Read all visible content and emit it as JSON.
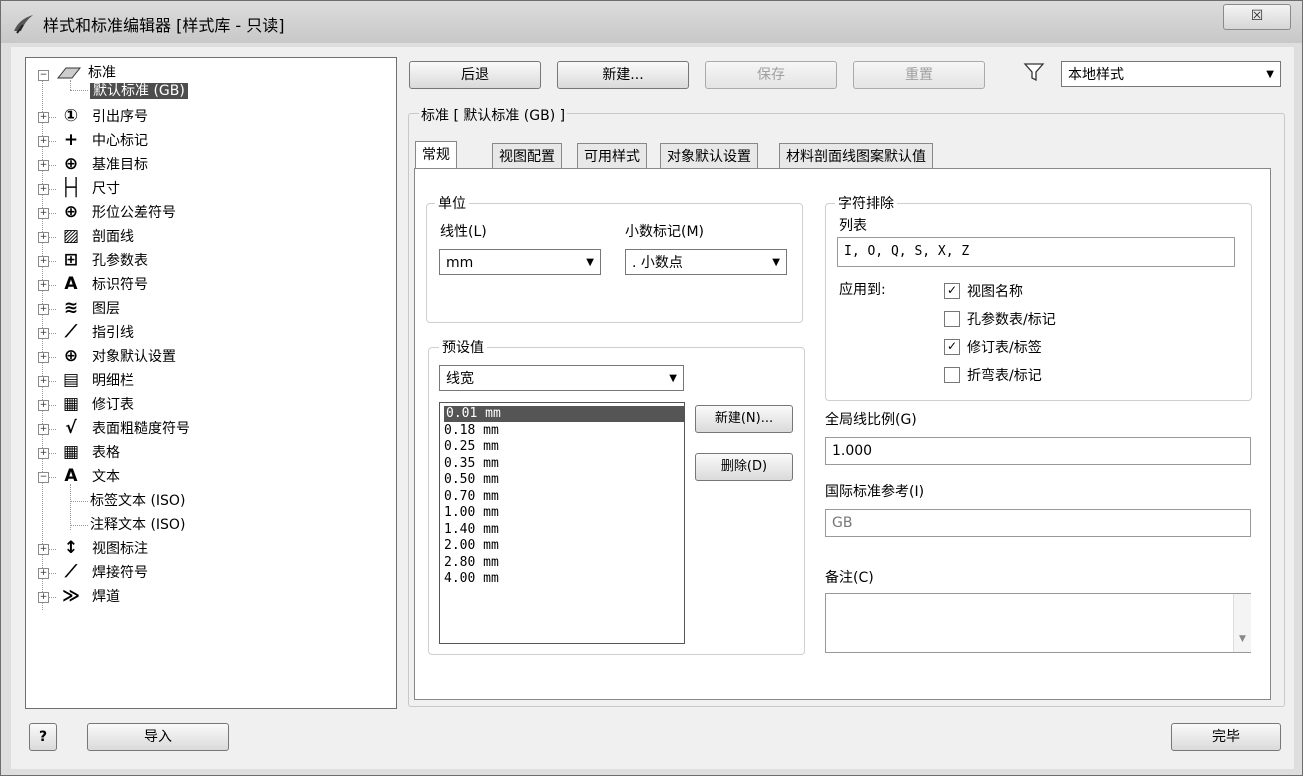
{
  "window": {
    "title": "样式和标准编辑器 [样式库 - 只读]",
    "close_label": "☒"
  },
  "tree": {
    "root_label": "标准",
    "selected_label": "默认标准 (GB)",
    "items": [
      {
        "label": "引出序号",
        "icon": "balloon-icon",
        "glyph": "①"
      },
      {
        "label": "中心标记",
        "icon": "center-mark-icon",
        "glyph": "+"
      },
      {
        "label": "基准目标",
        "icon": "datum-target-icon",
        "glyph": "⊕"
      },
      {
        "label": "尺寸",
        "icon": "dimension-icon",
        "glyph": "├┤"
      },
      {
        "label": "形位公差符号",
        "icon": "feature-control-frame-icon",
        "glyph": "⊕"
      },
      {
        "label": "剖面线",
        "icon": "hatch-icon",
        "glyph": "▨"
      },
      {
        "label": "孔参数表",
        "icon": "hole-table-icon",
        "glyph": "⊞"
      },
      {
        "label": "标识符号",
        "icon": "identifier-symbol-icon",
        "glyph": "A"
      },
      {
        "label": "图层",
        "icon": "layers-icon",
        "glyph": "≋"
      },
      {
        "label": "指引线",
        "icon": "leader-icon",
        "glyph": "⟋"
      },
      {
        "label": "对象默认设置",
        "icon": "globe-icon",
        "glyph": "⊕"
      },
      {
        "label": "明细栏",
        "icon": "parts-list-icon",
        "glyph": "▤"
      },
      {
        "label": "修订表",
        "icon": "revision-table-icon",
        "glyph": "▦"
      },
      {
        "label": "表面粗糙度符号",
        "icon": "surface-texture-icon",
        "glyph": "√"
      },
      {
        "label": "表格",
        "icon": "table-icon",
        "glyph": "▦"
      },
      {
        "label": "文本",
        "icon": "text-icon",
        "glyph": "A"
      }
    ],
    "text_children": [
      "标签文本 (ISO)",
      "注释文本 (ISO)"
    ],
    "tail_items": [
      {
        "label": "视图标注",
        "icon": "view-annotation-icon",
        "glyph": "↕"
      },
      {
        "label": "焊接符号",
        "icon": "weld-symbol-icon",
        "glyph": "⟋"
      },
      {
        "label": "焊道",
        "icon": "weld-bead-icon",
        "glyph": "≫"
      }
    ]
  },
  "toolbar": {
    "back_label": "后退",
    "new_label": "新建...",
    "save_label": "保存",
    "reset_label": "重置",
    "filter_value": "本地样式"
  },
  "section_title": "标准 [ 默认标准 (GB) ]",
  "tabs": [
    "常规",
    "视图配置",
    "可用样式",
    "对象默认设置",
    "材料剖面线图案默认值"
  ],
  "units": {
    "group_title": "单位",
    "linear_label": "线性(L)",
    "linear_value": "mm",
    "decimal_label": "小数标记(M)",
    "decimal_value": ". 小数点"
  },
  "presets": {
    "group_title": "预设值",
    "type_value": "线宽",
    "values": [
      "0.01 mm",
      "0.18 mm",
      "0.25 mm",
      "0.35 mm",
      "0.50 mm",
      "0.70 mm",
      "1.00 mm",
      "1.40 mm",
      "2.00 mm",
      "2.80 mm",
      "4.00 mm"
    ],
    "new_label": "新建(N)...",
    "delete_label": "删除(D)"
  },
  "char_exclusion": {
    "group_title": "字符排除",
    "list_label": "列表",
    "list_value": "I, O, Q, S, X, Z",
    "apply_label": "应用到:",
    "options": [
      {
        "label": "视图名称",
        "checked": true
      },
      {
        "label": "孔参数表/标记",
        "checked": false
      },
      {
        "label": "修订表/标签",
        "checked": true
      },
      {
        "label": "折弯表/标记",
        "checked": false
      }
    ]
  },
  "global_scale": {
    "label": "全局线比例(G)",
    "value": "1.000"
  },
  "intl_ref": {
    "label": "国际标准参考(I)",
    "value": "GB"
  },
  "notes": {
    "label": "备注(C)",
    "value": ""
  },
  "footer": {
    "help_label": "?",
    "import_label": "导入",
    "done_label": "完毕"
  }
}
